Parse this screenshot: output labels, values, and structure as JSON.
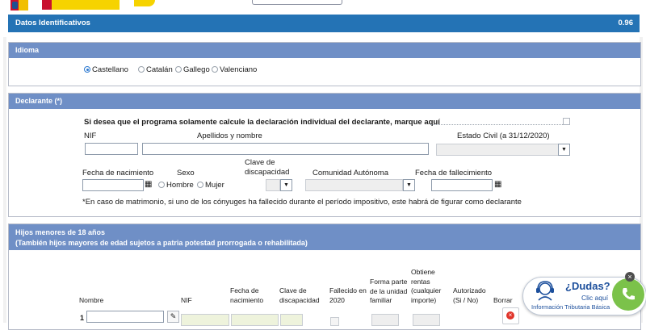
{
  "main_header": {
    "title": "Datos Identificativos",
    "version": "0.96"
  },
  "idioma": {
    "title": "Idioma",
    "options": [
      "Castellano",
      "Catalán",
      "Gallego",
      "Valenciano"
    ],
    "selected": "Castellano"
  },
  "declarante": {
    "title": "Declarante (*)",
    "instruction": "Si desea que el programa solamente calcule la declaración individual del declarante, marque aquí",
    "nif_label": "NIF",
    "apellidos_label": "Apellidos y nombre",
    "estado_civil_label": "Estado Civil (a 31/12/2020)",
    "fecha_nacimiento_label": "Fecha de nacimiento",
    "sexo_label": "Sexo",
    "hombre_label": "Hombre",
    "mujer_label": "Mujer",
    "clave_discapacidad_label": "Clave de\ndiscapacidad",
    "comunidad_label": "Comunidad Autónoma",
    "fecha_fallecimiento_label": "Fecha de fallecimiento",
    "note": "*En caso de matrimonio, si uno de los cónyuges ha fallecido durante el período impositivo, este habrá de figurar como declarante"
  },
  "hijos": {
    "title_line1": "Hijos menores de 18 años",
    "title_line2": "(También hijos mayores de edad sujetos a patria potestad prorrogada o rehabilitada)",
    "columns": {
      "nombre": "Nombre",
      "nif": "NIF",
      "fecha_nacimiento": "Fecha de\nnacimiento",
      "clave_discapacidad": "Clave de\ndiscapacidad",
      "fallecido": "Fallecido en\n2020",
      "forma_parte": "Forma parte\nde la unidad\nfamiliar",
      "obtiene_rentas": "Obtiene\nrentas\n(cualquier\nimporte)",
      "autorizado": "Autorizado\n(Si / No)",
      "borrar": "Borrar"
    },
    "row_number": "1"
  },
  "help_widget": {
    "question": "¿Dudas?",
    "link": "Clic aquí",
    "info": "Información Tributaria Básica",
    "close": "×"
  },
  "colors": {
    "header_blue": "#2473b5",
    "section_blue": "#6f8fc6",
    "link_blue": "#1c4f9c",
    "phone_green": "#7bc24a"
  },
  "icons": [
    "calendar-icon",
    "chevron-down-icon",
    "pencil-icon",
    "delete-icon",
    "agent-icon",
    "phone-icon",
    "close-icon"
  ]
}
